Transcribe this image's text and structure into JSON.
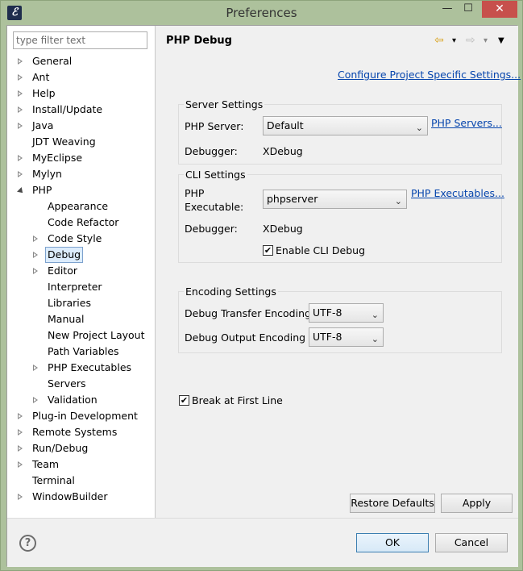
{
  "window": {
    "title": "Preferences",
    "icon": "eclipse-icon",
    "min": "—",
    "max": "☐",
    "close": "✕"
  },
  "filter": {
    "placeholder": "type filter text"
  },
  "tree": [
    {
      "label": "General",
      "level": 0,
      "state": "closed"
    },
    {
      "label": "Ant",
      "level": 0,
      "state": "closed"
    },
    {
      "label": "Help",
      "level": 0,
      "state": "closed"
    },
    {
      "label": "Install/Update",
      "level": 0,
      "state": "closed"
    },
    {
      "label": "Java",
      "level": 0,
      "state": "closed"
    },
    {
      "label": "JDT Weaving",
      "level": 0,
      "state": "leaf"
    },
    {
      "label": "MyEclipse",
      "level": 0,
      "state": "closed"
    },
    {
      "label": "Mylyn",
      "level": 0,
      "state": "closed"
    },
    {
      "label": "PHP",
      "level": 0,
      "state": "open"
    },
    {
      "label": "Appearance",
      "level": 1,
      "state": "leaf"
    },
    {
      "label": "Code Refactor",
      "level": 1,
      "state": "leaf"
    },
    {
      "label": "Code Style",
      "level": 1,
      "state": "closed"
    },
    {
      "label": "Debug",
      "level": 1,
      "state": "closed",
      "selected": true
    },
    {
      "label": "Editor",
      "level": 1,
      "state": "closed"
    },
    {
      "label": "Interpreter",
      "level": 1,
      "state": "leaf"
    },
    {
      "label": "Libraries",
      "level": 1,
      "state": "leaf"
    },
    {
      "label": "Manual",
      "level": 1,
      "state": "leaf"
    },
    {
      "label": "New Project Layout",
      "level": 1,
      "state": "leaf"
    },
    {
      "label": "Path Variables",
      "level": 1,
      "state": "leaf"
    },
    {
      "label": "PHP Executables",
      "level": 1,
      "state": "closed"
    },
    {
      "label": "Servers",
      "level": 1,
      "state": "leaf"
    },
    {
      "label": "Validation",
      "level": 1,
      "state": "closed"
    },
    {
      "label": "Plug-in Development",
      "level": 0,
      "state": "closed"
    },
    {
      "label": "Remote Systems",
      "level": 0,
      "state": "closed"
    },
    {
      "label": "Run/Debug",
      "level": 0,
      "state": "closed"
    },
    {
      "label": "Team",
      "level": 0,
      "state": "closed"
    },
    {
      "label": "Terminal",
      "level": 0,
      "state": "leaf"
    },
    {
      "label": "WindowBuilder",
      "level": 0,
      "state": "closed"
    }
  ],
  "page": {
    "title": "PHP Debug",
    "nav": {
      "back": "⇦",
      "forward": "⇨",
      "dropdown": "▾",
      "menu": "▼"
    },
    "configure_link": "Configure Project Specific Settings...",
    "server": {
      "title": "Server Settings",
      "server_label": "PHP Server:",
      "server_value": "Default",
      "servers_link": "PHP Servers...",
      "debugger_label": "Debugger:",
      "debugger_value": "XDebug"
    },
    "cli": {
      "title": "CLI Settings",
      "exe_label_1": "PHP",
      "exe_label_2": "Executable:",
      "exe_value": "phpserver",
      "exe_link": "PHP Executables...",
      "debugger_label": "Debugger:",
      "debugger_value": "XDebug",
      "enable_label": "Enable CLI Debug",
      "enable_checked": true
    },
    "encoding": {
      "title": "Encoding Settings",
      "transfer_label": "Debug Transfer Encoding",
      "transfer_value": "UTF-8",
      "output_label": "Debug Output Encoding",
      "output_value": "UTF-8"
    },
    "break_label": "Break at First Line",
    "break_checked": true,
    "restore_label": "Restore Defaults",
    "apply_label": "Apply"
  },
  "footer": {
    "help_icon": "?",
    "ok_label": "OK",
    "cancel_label": "Cancel"
  },
  "colors": {
    "link": "#0645ad",
    "selection": "#dcecfc",
    "frame": "#adc19c"
  }
}
